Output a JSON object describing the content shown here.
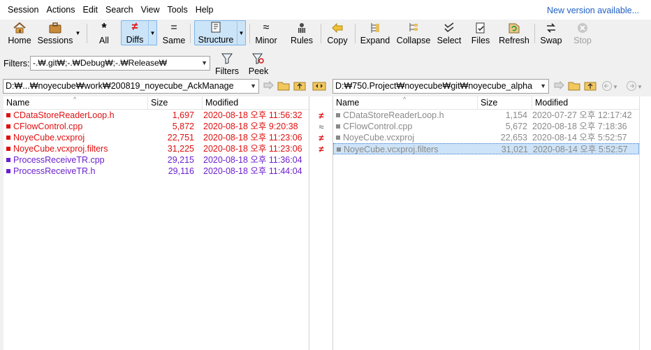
{
  "menu": [
    "Session",
    "Actions",
    "Edit",
    "Search",
    "View",
    "Tools",
    "Help"
  ],
  "new_version": "New version available...",
  "toolbar": {
    "home": "Home",
    "sessions": "Sessions",
    "all": "All",
    "diffs": "Diffs",
    "same": "Same",
    "structure": "Structure",
    "minor": "Minor",
    "rules": "Rules",
    "copy": "Copy",
    "expand": "Expand",
    "collapse": "Collapse",
    "select": "Select",
    "files": "Files",
    "refresh": "Refresh",
    "swap": "Swap",
    "stop": "Stop"
  },
  "filter": {
    "label": "Filters:",
    "value": "-.₩.git₩;-.₩Debug₩;-.₩Release₩",
    "filters_button": "Filters",
    "peek_button": "Peek"
  },
  "left": {
    "path": "D:₩...₩noyecube₩work₩200819_noyecube_AckManage",
    "columns": {
      "name": "Name",
      "size": "Size",
      "modified": "Modified"
    },
    "rows": [
      {
        "name": "CDataStoreReaderLoop.h",
        "size": "1,697",
        "modified": "2020-08-18 오후 11:56:32"
      },
      {
        "name": "CFlowControl.cpp",
        "size": "5,872",
        "modified": "2020-08-18 오후 9:20:38"
      },
      {
        "name": "NoyeCube.vcxproj",
        "size": "22,751",
        "modified": "2020-08-18 오후 11:23:06"
      },
      {
        "name": "NoyeCube.vcxproj.filters",
        "size": "31,225",
        "modified": "2020-08-18 오후 11:23:06"
      },
      {
        "name": "ProcessReceiveTR.cpp",
        "size": "29,215",
        "modified": "2020-08-18 오후 11:36:04"
      },
      {
        "name": "ProcessReceiveTR.h",
        "size": "29,116",
        "modified": "2020-08-18 오후 11:44:04"
      }
    ]
  },
  "gutter_marks": [
    "≠",
    "≈",
    "≠",
    "≠"
  ],
  "right": {
    "path": "D:₩750.Project₩noyecube₩git₩noyecube_alpha",
    "columns": {
      "name": "Name",
      "size": "Size",
      "modified": "Modified"
    },
    "rows": [
      {
        "name": "CDataStoreReaderLoop.h",
        "size": "1,154",
        "modified": "2020-07-27 오후 12:17:42"
      },
      {
        "name": "CFlowControl.cpp",
        "size": "5,672",
        "modified": "2020-08-18 오후 7:18:36"
      },
      {
        "name": "NoyeCube.vcxproj",
        "size": "22,653",
        "modified": "2020-08-14 오후 5:52:57"
      },
      {
        "name": "NoyeCube.vcxproj.filters",
        "size": "31,021",
        "modified": "2020-08-14 오후 5:52:57"
      }
    ]
  },
  "colors": {
    "diff_red": "#e01010",
    "orphan_purple": "#6a1fcf",
    "older_gray": "#8a8a8a",
    "selection": "#cde3f7",
    "link_blue": "#1f5fc4"
  }
}
